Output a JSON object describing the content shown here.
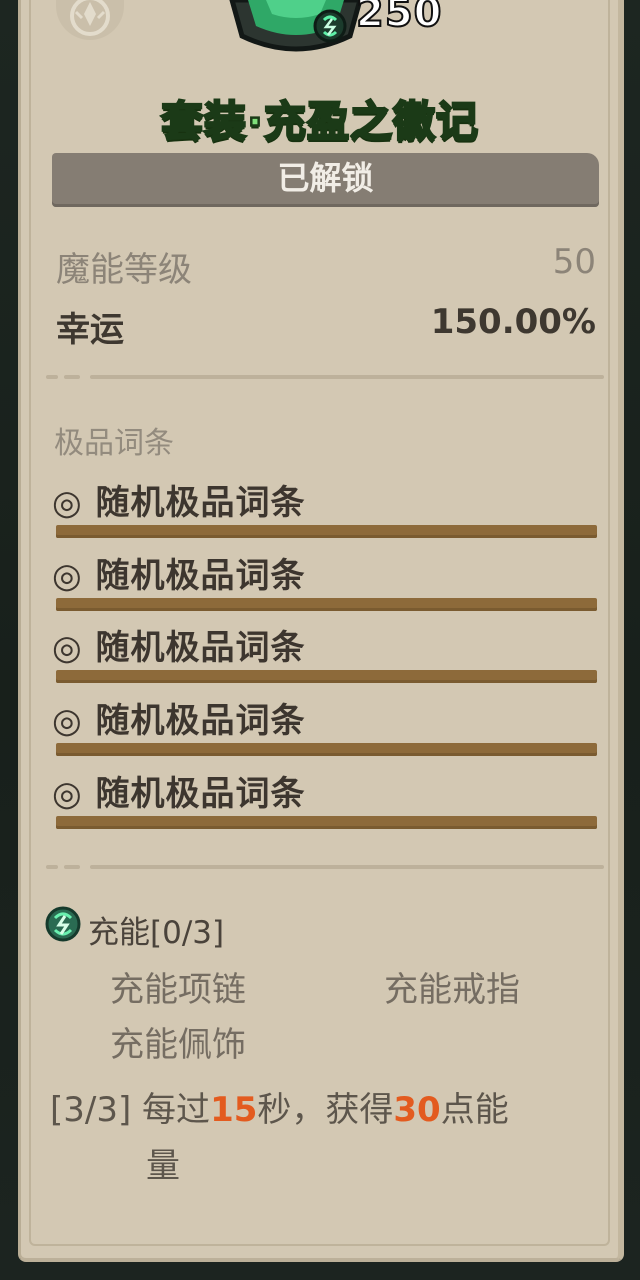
{
  "item": {
    "level": "250",
    "set_title": "套装·充盈之徽记",
    "status": "已解锁"
  },
  "stats": [
    {
      "label": "魔能等级",
      "value": "50"
    },
    {
      "label": "幸运",
      "value": "150.00%"
    }
  ],
  "affixes": {
    "section_title": "极品词条",
    "items": [
      {
        "text": "◎ 随机极品词条"
      },
      {
        "text": "◎ 随机极品词条"
      },
      {
        "text": "◎ 随机极品词条"
      },
      {
        "text": "◎ 随机极品词条"
      },
      {
        "text": "◎ 随机极品词条"
      }
    ]
  },
  "charge_set": {
    "title": "充能[0/3]",
    "pieces": [
      "充能项链",
      "充能戒指",
      "充能佩饰"
    ],
    "bonus": {
      "prefix": "[3/3] 每过",
      "seconds": "15",
      "middle": "秒，获得",
      "points": "30",
      "suffix": "点能",
      "wrap": "量"
    }
  },
  "colors": {
    "panel": "#d3c8b3",
    "title_green": "#7fe07a",
    "affix_bar": "#8d6a3a",
    "highlight_orange": "#e35b1f",
    "unlock_bar": "#857d73"
  },
  "icons": [
    "emblem-icon",
    "item-badge-icon",
    "charge-icon"
  ]
}
